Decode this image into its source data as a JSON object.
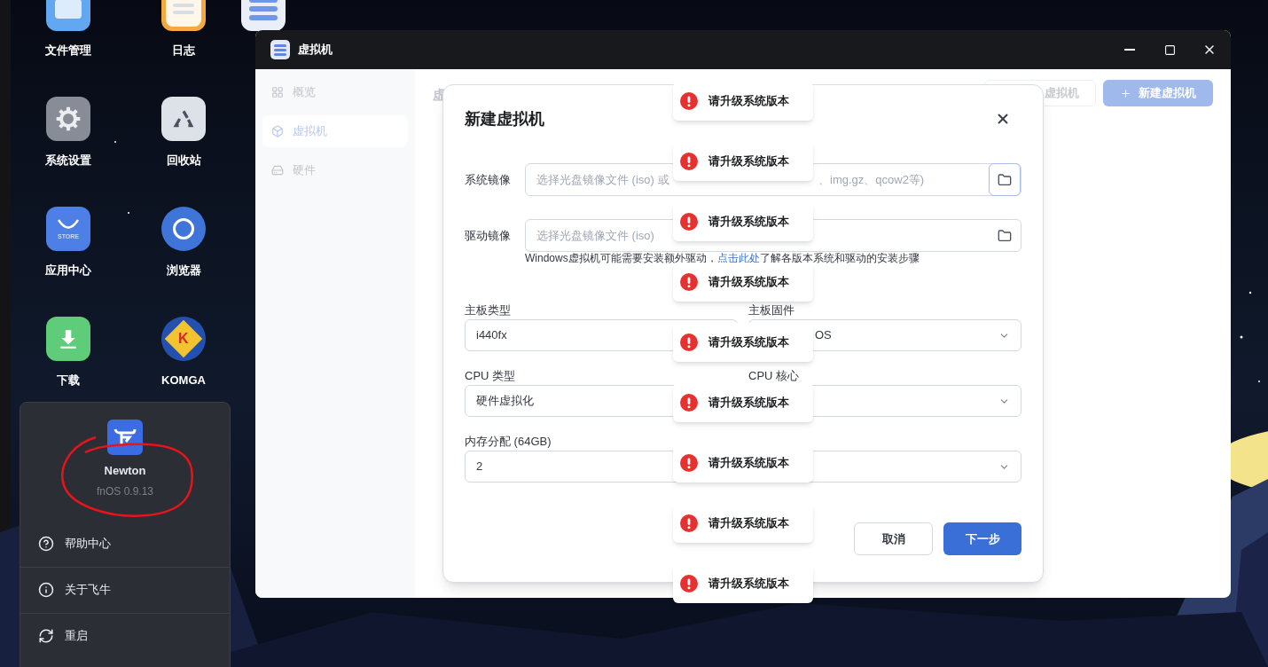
{
  "desktop_icons": [
    {
      "label": "文件管理",
      "kind": "files"
    },
    {
      "label": "系统设置",
      "kind": "settings"
    },
    {
      "label": "应用中心",
      "kind": "store",
      "icon_text": "STORE"
    },
    {
      "label": "下载",
      "kind": "download"
    },
    {
      "label": "日志",
      "kind": "log"
    },
    {
      "label": "回收站",
      "kind": "recycle"
    },
    {
      "label": "浏览器",
      "kind": "browser"
    },
    {
      "label": "KOMGA",
      "kind": "komga",
      "icon_text": "K"
    }
  ],
  "partial_icon": {
    "kind": "server"
  },
  "start_menu": {
    "user": "Newton",
    "version": "fnOS 0.9.13",
    "items": [
      {
        "label": "帮助中心",
        "kind": "help"
      },
      {
        "label": "关于飞牛",
        "kind": "info"
      },
      {
        "label": "重启",
        "kind": "restart"
      }
    ]
  },
  "window": {
    "title": "虚拟机",
    "sidebar": [
      {
        "label": "概览",
        "kind": "overview",
        "selected": false
      },
      {
        "label": "虚拟机",
        "kind": "vm",
        "selected": true
      },
      {
        "label": "硬件",
        "kind": "hardware",
        "selected": false
      }
    ],
    "header_title": "虚",
    "header_buttons": [
      {
        "label": "虚拟机",
        "kind": "outline"
      },
      {
        "label": "新建虚拟机",
        "kind": "primary"
      }
    ]
  },
  "dialog": {
    "title": "新建虚拟机",
    "file_fields": [
      {
        "label": "系统镜像",
        "placeholder": [
          "选择光盘镜像文件 (iso) 或",
          "、img.gz、qcow2等)"
        ],
        "focused": true
      },
      {
        "label": "驱动镜像",
        "placeholder": [
          "选择光盘镜像文件 (iso)"
        ],
        "focused": false
      }
    ],
    "hint": {
      "before": "Windows虚拟机可能需要安装额外驱动，",
      "link": "点击此处",
      "after": "了解各版本系统和驱动的安装步骤"
    },
    "fields": [
      {
        "label": "主板类型",
        "value": "i440fx",
        "kind": "input"
      },
      {
        "label": "主板固件",
        "value": "OS",
        "kind": "select"
      },
      {
        "label": "CPU 类型",
        "value": "硬件虚拟化",
        "kind": "input"
      },
      {
        "label": "CPU 核心",
        "kind": "select"
      },
      {
        "label": "内存分配 (64GB)",
        "value": "2",
        "kind": "input"
      },
      {
        "kind": "select"
      }
    ],
    "buttons": [
      {
        "label": "取消",
        "kind": "secondary"
      },
      {
        "label": "下一步",
        "kind": "primary"
      }
    ]
  },
  "toasts": [
    {
      "message": "请升级系统版本"
    },
    {
      "message": "请升级系统版本"
    },
    {
      "message": "请升级系统版本"
    },
    {
      "message": "请升级系统版本"
    },
    {
      "message": "请升级系统版本"
    },
    {
      "message": "请升级系统版本"
    },
    {
      "message": "请升级系统版本"
    },
    {
      "message": "请升级系统版本"
    },
    {
      "message": "请升级系统版本"
    }
  ]
}
